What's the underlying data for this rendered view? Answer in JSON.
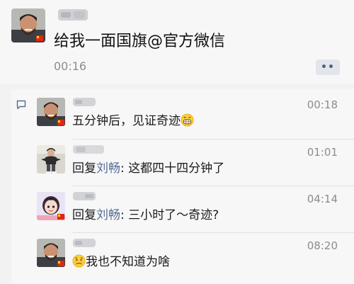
{
  "post": {
    "text": "给我一面国旗@官方微信",
    "time": "00:16",
    "more_label": "••"
  },
  "comments": [
    {
      "time": "00:18",
      "text": "五分钟后，见证奇迹",
      "emoji": "grinning-face"
    },
    {
      "time": "01:01",
      "reply_prefix": "回复",
      "mention": "刘畅",
      "text": ": 这都四十四分钟了"
    },
    {
      "time": "04:14",
      "reply_prefix": "回复",
      "mention": "刘畅",
      "text": ": 三小时了～奇迹?"
    },
    {
      "time": "08:20",
      "emoji": "confused-face",
      "text": "我也不知道为啥"
    }
  ],
  "colors": {
    "mention": "#576b95",
    "flag_red": "#de2910",
    "flag_yellow": "#ffde00",
    "time_gray": "#8c8c8c"
  }
}
